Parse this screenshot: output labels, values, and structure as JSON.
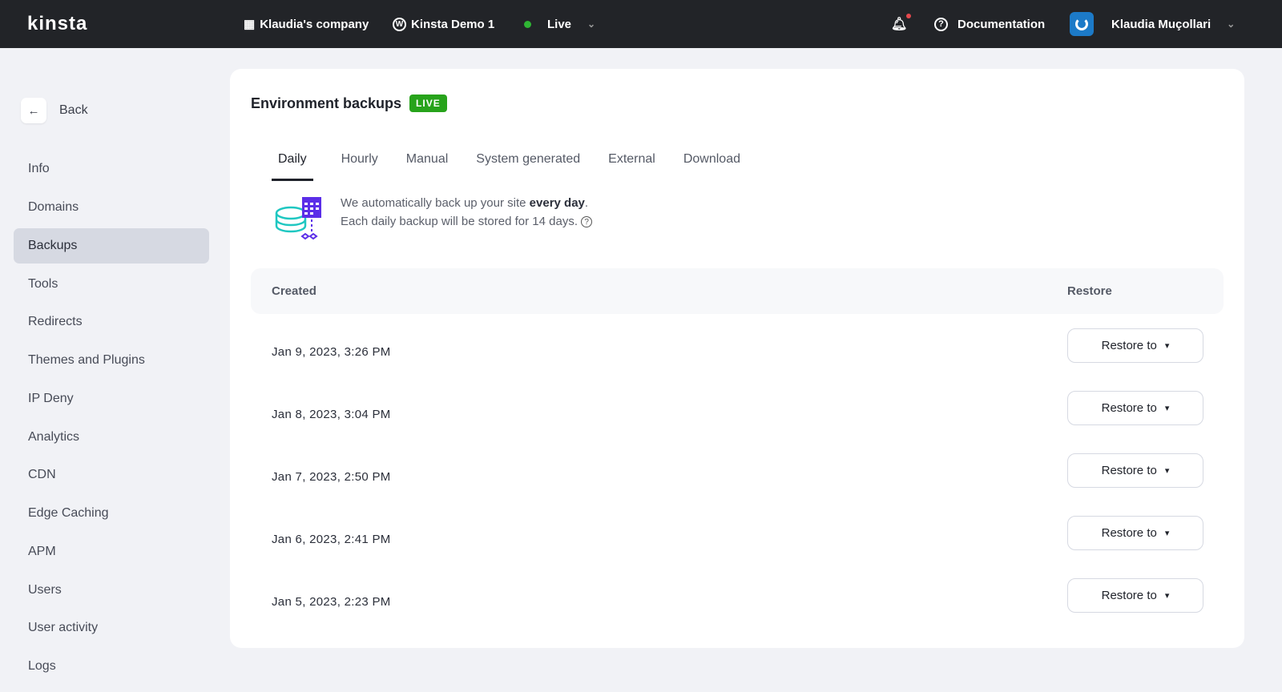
{
  "topbar": {
    "logo": "kinsta",
    "company": "Klaudia's company",
    "site": "Kinsta Demo 1",
    "environment": "Live",
    "documentation": "Documentation",
    "user": "Klaudia Muçollari"
  },
  "sidebar": {
    "back": "Back",
    "items": [
      "Info",
      "Domains",
      "Backups",
      "Tools",
      "Redirects",
      "Themes and Plugins",
      "IP Deny",
      "Analytics",
      "CDN",
      "Edge Caching",
      "APM",
      "Users",
      "User activity",
      "Logs"
    ],
    "active": "Backups"
  },
  "main": {
    "title": "Environment backups",
    "badge": "LIVE",
    "tabs": [
      "Daily",
      "Hourly",
      "Manual",
      "System generated",
      "External",
      "Download"
    ],
    "active_tab": "Daily",
    "info_line1_prefix": "We automatically back up your site ",
    "info_line1_bold": "every day",
    "info_line1_suffix": ".",
    "info_line2": "Each daily backup will be stored for 14 days.",
    "table": {
      "headers": [
        "Created",
        "Restore"
      ],
      "button_label": "Restore to",
      "rows": [
        "Jan 9, 2023, 3:26 PM",
        "Jan 8, 2023, 3:04 PM",
        "Jan 7, 2023, 2:50 PM",
        "Jan 6, 2023, 2:41 PM",
        "Jan 5, 2023, 2:23 PM"
      ]
    }
  },
  "colors": {
    "live_badge": "#27a31b",
    "status_dot": "#2fb534",
    "topbar": "#222428"
  }
}
